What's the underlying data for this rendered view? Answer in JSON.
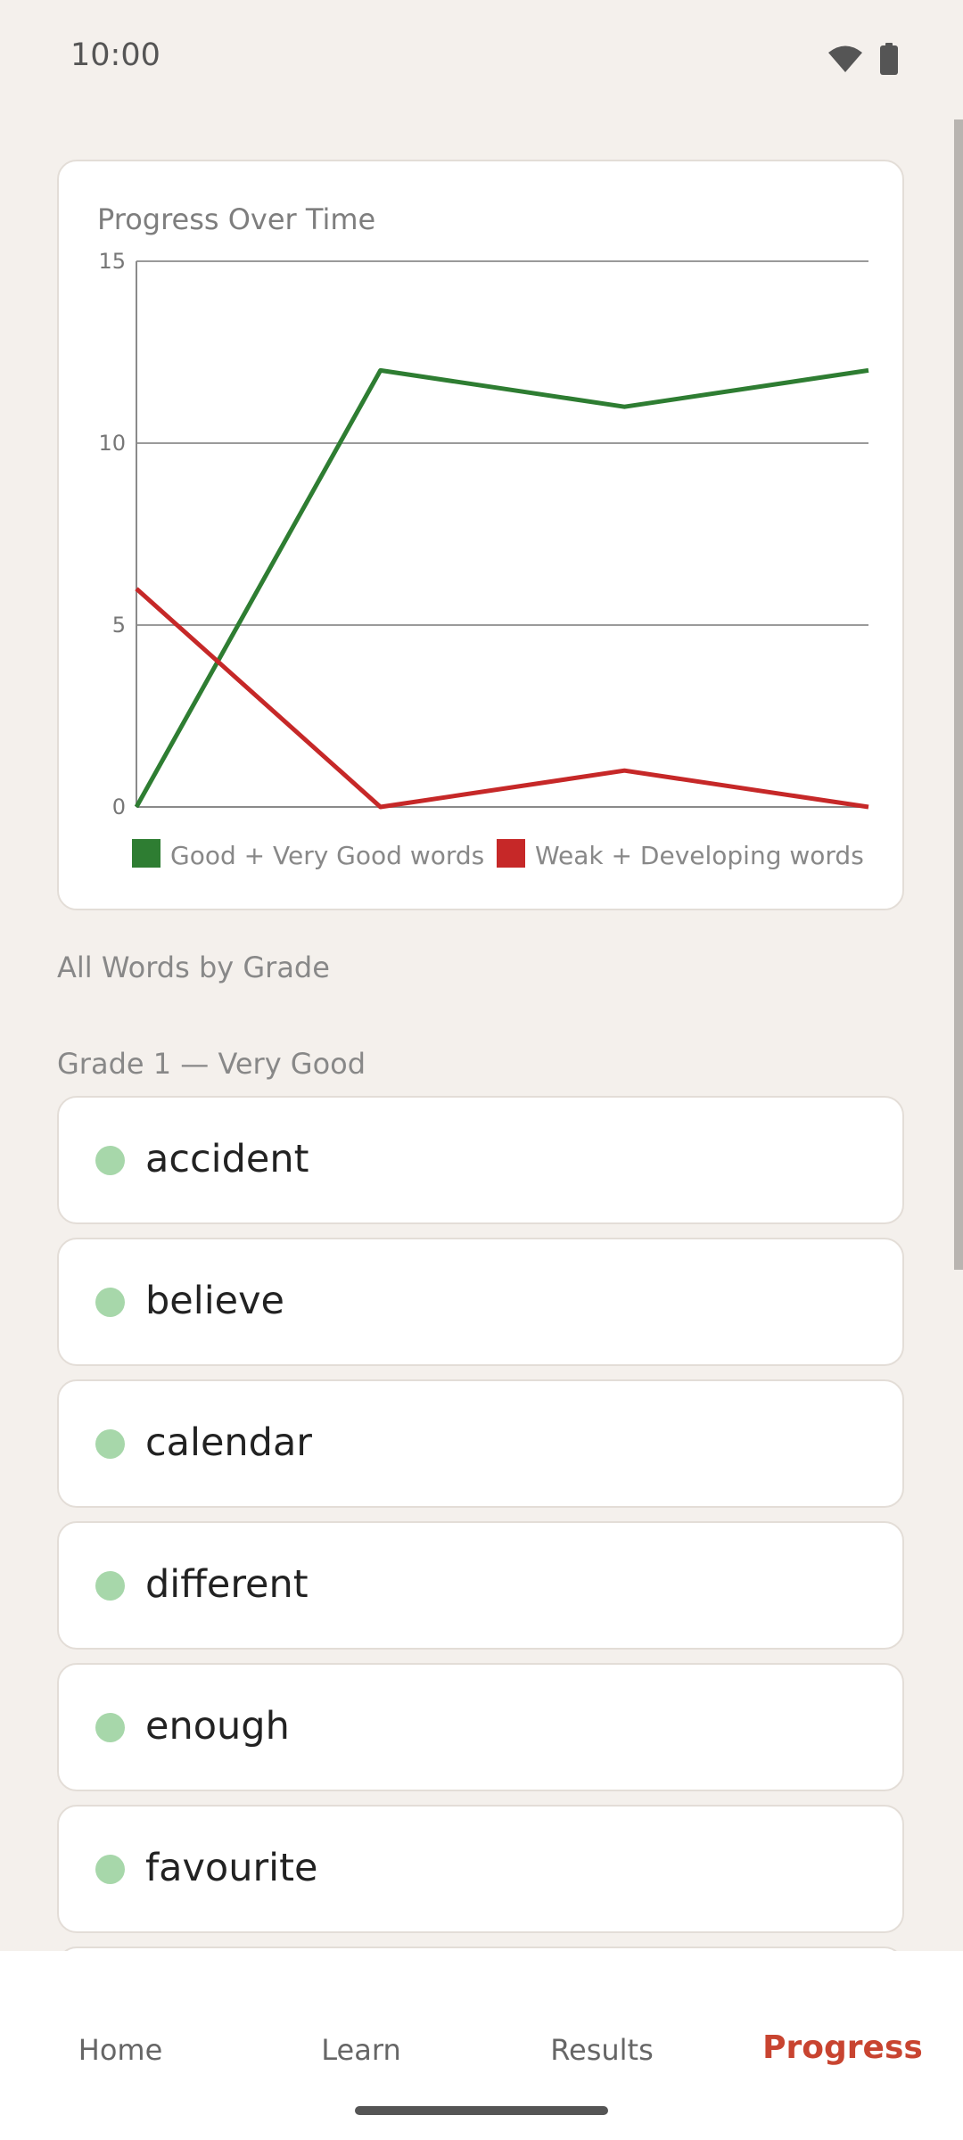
{
  "status": {
    "time": "10:00"
  },
  "chart": {
    "title": "Progress Over Time",
    "y_ticks": [
      "15",
      "10",
      "5",
      "0"
    ]
  },
  "chart_data": {
    "type": "line",
    "title": "Progress Over Time",
    "x": [
      1,
      2,
      3,
      4
    ],
    "ylim": [
      0,
      15
    ],
    "grid": true,
    "legend_placement": "bottom",
    "series": [
      {
        "name": "Good + Very Good words",
        "values": [
          0,
          12,
          11,
          12
        ],
        "color": "#2e7d32"
      },
      {
        "name": "Weak + Developing words",
        "values": [
          6,
          0,
          1,
          0
        ],
        "color": "#c62828"
      }
    ]
  },
  "sections": {
    "all_words": "All Words by Grade",
    "grade1": "Grade 1 — Very Good"
  },
  "words": [
    "accident",
    "believe",
    "calendar",
    "different",
    "enough",
    "favourite"
  ],
  "nav": {
    "items": [
      "Home",
      "Learn",
      "Results",
      "Progress"
    ],
    "active": "Progress"
  },
  "colors": {
    "accent": "#c84430",
    "good": "#2e7d32",
    "weak": "#c62828",
    "word_dot": "#a7d7aa"
  }
}
